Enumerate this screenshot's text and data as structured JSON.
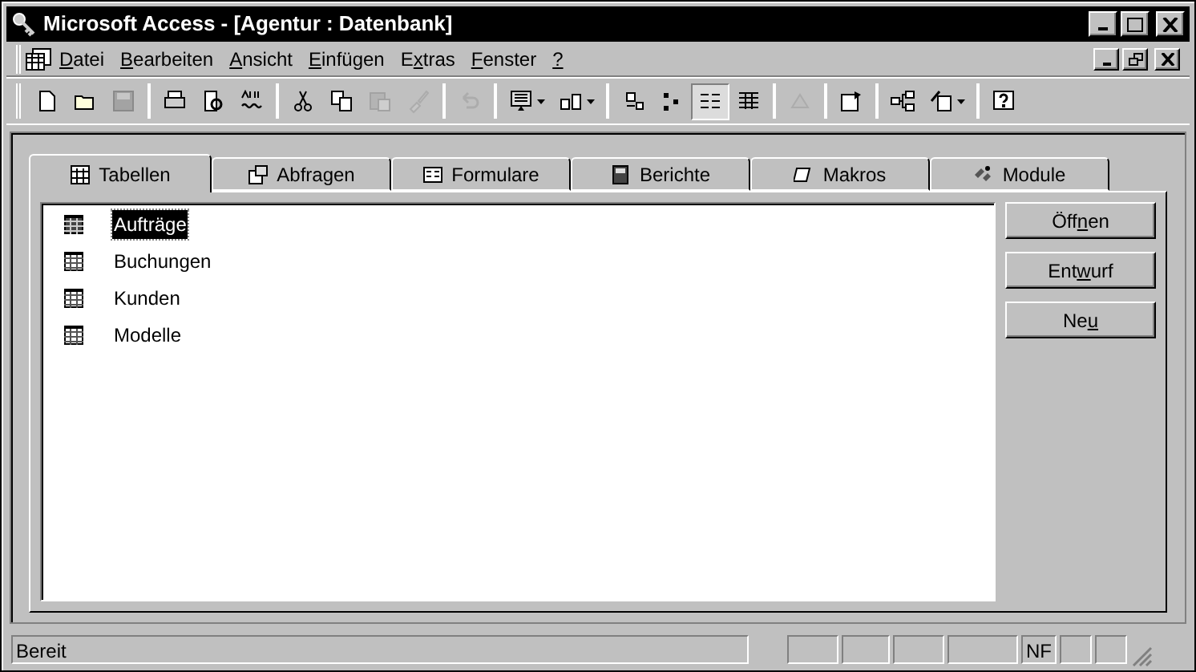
{
  "window": {
    "title": "Microsoft Access - [Agentur : Datenbank]"
  },
  "menu": [
    {
      "key": "D",
      "after": "atei"
    },
    {
      "key": "B",
      "after": "earbeiten"
    },
    {
      "key": "A",
      "after": "nsicht"
    },
    {
      "key": "E",
      "after": "infügen"
    },
    {
      "before": "E",
      "key": "x",
      "after": "tras"
    },
    {
      "key": "F",
      "after": "enster"
    },
    {
      "key": "?"
    }
  ],
  "toolbar": [
    {
      "disabled": false,
      "selected": false
    },
    {
      "disabled": false,
      "selected": false
    },
    {
      "disabled": true,
      "selected": false
    },
    {
      "disabled": false,
      "selected": false
    },
    {
      "disabled": false,
      "selected": false
    },
    {
      "disabled": false,
      "selected": false
    },
    {
      "disabled": false,
      "selected": false
    },
    {
      "disabled": false,
      "selected": false
    },
    {
      "disabled": true,
      "selected": false
    },
    {
      "disabled": true,
      "selected": false
    },
    {
      "disabled": true,
      "selected": false
    },
    {
      "disabled": false,
      "selected": false
    },
    {
      "disabled": false,
      "selected": false
    },
    {
      "disabled": false,
      "selected": false
    },
    {
      "disabled": false,
      "selected": false
    },
    {
      "disabled": false,
      "selected": true
    },
    {
      "disabled": false,
      "selected": false
    },
    {
      "disabled": true,
      "selected": false
    },
    {
      "disabled": false,
      "selected": false
    },
    {
      "disabled": false,
      "selected": false
    },
    {
      "disabled": false,
      "selected": false
    },
    {
      "disabled": false,
      "selected": false
    }
  ],
  "tabs": [
    {
      "label": "Tabellen",
      "selected": true
    },
    {
      "label": "Abfragen",
      "selected": false
    },
    {
      "label": "Formulare",
      "selected": false
    },
    {
      "label": "Berichte",
      "selected": false
    },
    {
      "label": "Makros",
      "selected": false
    },
    {
      "label": "Module",
      "selected": false
    }
  ],
  "items": [
    {
      "label": "Aufträge",
      "selected": true
    },
    {
      "label": "Buchungen",
      "selected": false
    },
    {
      "label": "Kunden",
      "selected": false
    },
    {
      "label": "Modelle",
      "selected": false
    }
  ],
  "buttons": [
    {
      "before": "Öff",
      "key": "n",
      "after": "en"
    },
    {
      "before": "Ent",
      "key": "w",
      "after": "urf"
    },
    {
      "before": "Ne",
      "key": "u"
    }
  ],
  "status_bar": {
    "message": "Bereit",
    "indicator": "NF"
  }
}
